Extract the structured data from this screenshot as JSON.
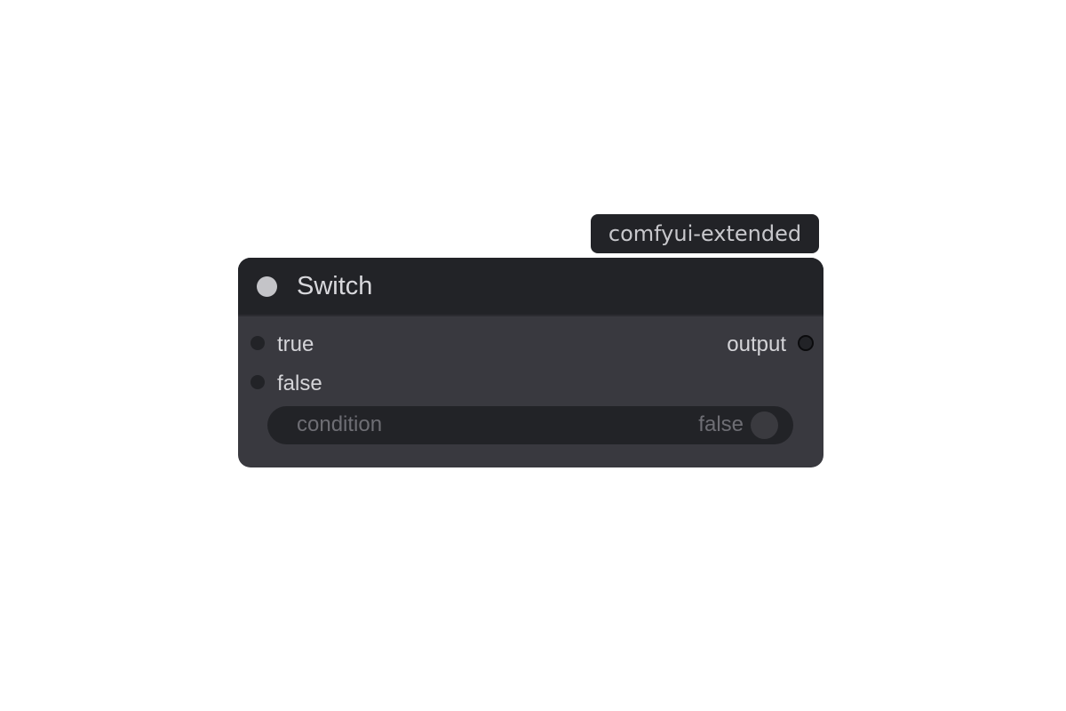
{
  "badge": {
    "label": "comfyui-extended"
  },
  "node": {
    "title": "Switch",
    "inputs": [
      {
        "label": "true"
      },
      {
        "label": "false"
      }
    ],
    "outputs": [
      {
        "label": "output"
      }
    ],
    "widgets": [
      {
        "label": "condition",
        "value": "false"
      }
    ]
  },
  "colors": {
    "node_body": "#39393f",
    "node_header": "#222327",
    "text": "#d4d4d8",
    "widget_text": "#6e6e74"
  }
}
